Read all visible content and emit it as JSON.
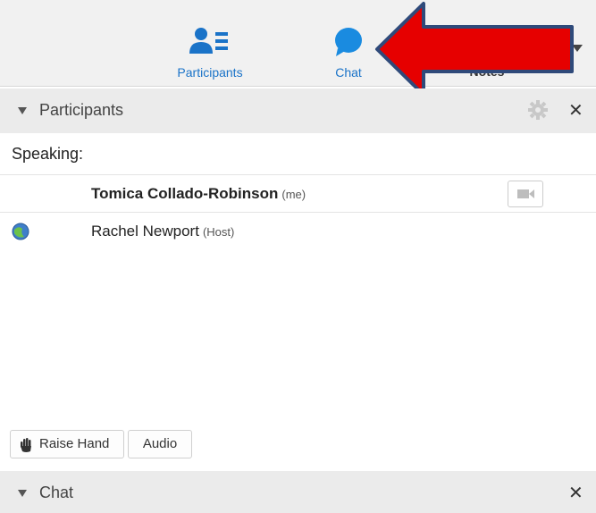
{
  "toolbar": {
    "participants_label": "Participants",
    "chat_label": "Chat",
    "notes_label": "Notes",
    "accent_color": "#1a73c8"
  },
  "participants_panel": {
    "title": "Participants",
    "speaking_label": "Speaking:",
    "participants": [
      {
        "name": "Tomica Collado-Robinson",
        "tag": "(me)"
      },
      {
        "name": "Rachel Newport",
        "tag": "(Host)"
      }
    ],
    "raise_hand_label": "Raise Hand",
    "audio_label": "Audio"
  },
  "chat_panel": {
    "title": "Chat"
  },
  "annotation": {
    "arrow_color": "#e60000",
    "arrow_outline": "#2f4a7a"
  }
}
